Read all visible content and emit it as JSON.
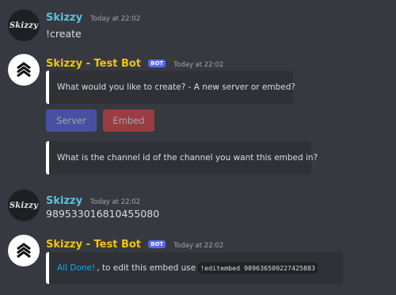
{
  "messages": [
    {
      "author": "Skizzy",
      "timestamp": "Today at 22:02",
      "avatar_text": "Skizzy",
      "content": "!create"
    },
    {
      "author": "Skizzy - Test Bot",
      "badge": "BOT",
      "timestamp": "Today at 22:02",
      "embeds": [
        "What would you like to create? - A new server or embed?",
        "What is the channel id of the channel you want this embed in?"
      ],
      "buttons": {
        "server": "Server",
        "embed": "Embed"
      }
    },
    {
      "author": "Skizzy",
      "timestamp": "Today at 22:02",
      "avatar_text": "Skizzy",
      "content": "989533016810455080"
    },
    {
      "author": "Skizzy - Test Bot",
      "badge": "BOT",
      "timestamp": "Today at 22:02",
      "final_embed": {
        "link_text": "All Done!",
        "text": ", to edit this embed use",
        "command": "!editembed 989636509227425883"
      }
    }
  ],
  "colors": {
    "background": "#36393f",
    "embed_bg": "#2f3136",
    "user_name": "#5bbfe3",
    "bot_name": "#f1c40f",
    "bot_badge": "#5865f2",
    "server_button": "#5865f2",
    "embed_button": "#ed4245",
    "link": "#00aff4"
  }
}
